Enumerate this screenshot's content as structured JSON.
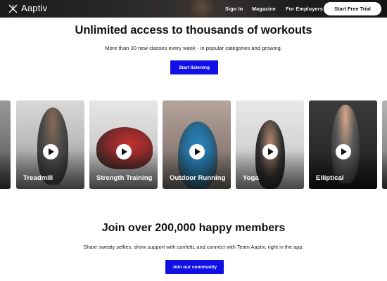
{
  "header": {
    "brand": "Aaptiv",
    "nav": {
      "sign_in": "Sign In",
      "magazine": "Magazine",
      "for_employers": "For Employers"
    },
    "cta": "Start Free Trial"
  },
  "hero": {
    "title": "Unlimited access to thousands of workouts",
    "subtitle": "More than 30 new classes every week - in popular categories and growing.",
    "button": "Start listening"
  },
  "carousel": {
    "cards": [
      {
        "label": "Treadmill",
        "icon": "play-icon"
      },
      {
        "label": "Strength Training",
        "icon": "play-icon"
      },
      {
        "label": "Outdoor Running",
        "icon": "play-icon"
      },
      {
        "label": "Yoga",
        "icon": "play-icon"
      },
      {
        "label": "Elliptical",
        "icon": "play-icon"
      }
    ]
  },
  "community": {
    "title": "Join over 200,000 happy members",
    "subtitle": "Share sweaty selfies, show support with confetti, and connect with Team Aaptiv, right in the app.",
    "button": "Join our community"
  },
  "colors": {
    "accent": "#1010e6",
    "header_bg": "#1e1e1e",
    "text": "#111111"
  }
}
